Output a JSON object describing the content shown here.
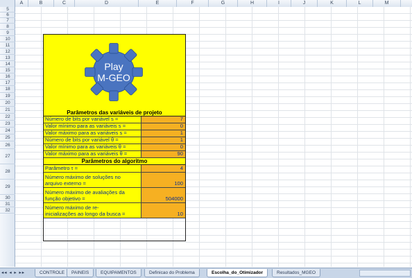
{
  "columns": [
    "A",
    "B",
    "C",
    "D",
    "E",
    "F",
    "G",
    "H",
    "I",
    "J",
    "K",
    "L",
    "M"
  ],
  "rows": [
    "5",
    "6",
    "7",
    "8",
    "9",
    "10",
    "11",
    "12",
    "13",
    "14",
    "15",
    "16",
    "17",
    "18",
    "19",
    "20",
    "21",
    "22",
    "23",
    "24",
    "25",
    "26",
    "27",
    "28",
    "29",
    "30",
    "31",
    "32"
  ],
  "logo": {
    "line1": "Play",
    "line2": "M-GEO",
    "gear_color": "#4a74c0",
    "background": "#ffff00"
  },
  "section_design_vars": {
    "title": "Parâmetros das variáveis de projeto",
    "params": [
      {
        "label": "Número de bits por variável s =",
        "value": "7"
      },
      {
        "label": "Valor mínimo para as variáveis s =",
        "value": "0"
      },
      {
        "label": "Valor máximo para as variáveis s =",
        "value": "1"
      },
      {
        "label": "Número de bits por variável θ =",
        "value": "1"
      },
      {
        "label": "Valor mínimo para as variáveis θ =",
        "value": "0"
      },
      {
        "label": "Valor máximo para as variáveis θ =",
        "value": "90"
      }
    ]
  },
  "section_algorithm": {
    "title": "Parâmetros do algoritmo",
    "params": [
      {
        "label": "Parâmetro τ =",
        "value": "4"
      },
      {
        "label": "Número máximo de soluções no\narquivo externo =",
        "value": "100"
      },
      {
        "label": "Número máximo de avaliações da\nfunção objetivo =",
        "value": "504000"
      },
      {
        "label": "Número máximo de re-\ninicializações ao longo da busca =",
        "value": "10"
      }
    ]
  },
  "sheet_tabs": [
    {
      "label": "CONTROLE",
      "active": false
    },
    {
      "label": "PAINEIS",
      "active": false
    },
    {
      "label": "EQUIPAMENTOS",
      "active": false
    },
    {
      "label": "Definicao do Problema",
      "active": false
    },
    {
      "label": "Escolha_do_Otimizador",
      "active": true
    },
    {
      "label": "Resultados_MGEO",
      "active": false
    }
  ],
  "tab_nav": "◂◂ ◂ ▸ ▸▸",
  "colors": {
    "label_bg": "#ffff00",
    "value_bg": "#f6b022",
    "text": "#0b2f8f"
  }
}
